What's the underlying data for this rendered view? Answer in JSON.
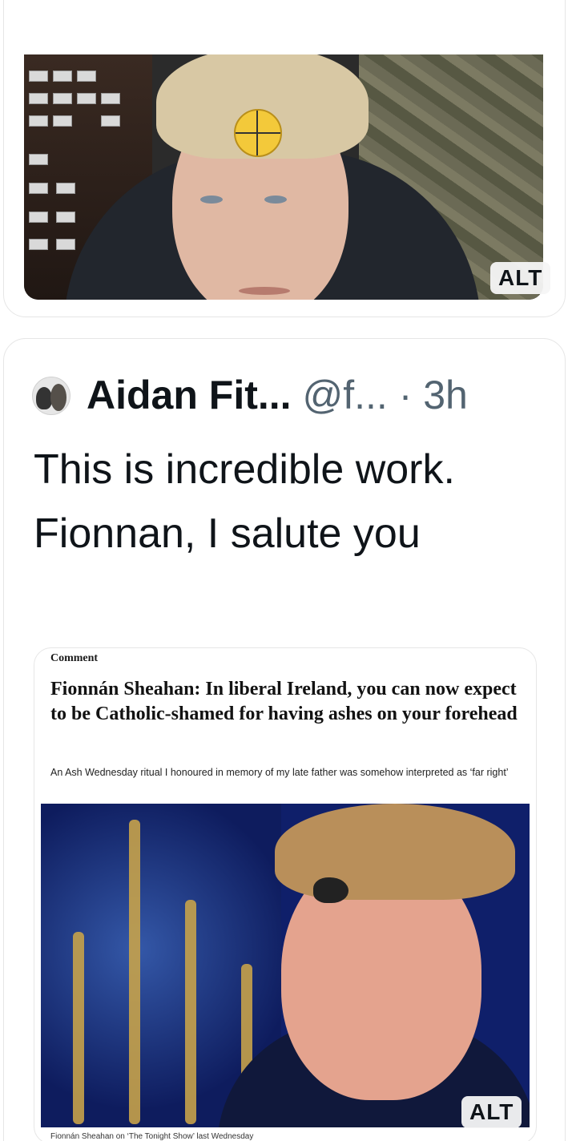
{
  "previous_tweet": {
    "image_alt_badge": "ALT"
  },
  "tweet": {
    "author_name": "Aidan Fit...",
    "handle": "@f...",
    "separator": "·",
    "time": "3h",
    "text": "This is incredible work. Fionnan, I salute you",
    "image_alt_badge": "ALT"
  },
  "article": {
    "section": "Comment",
    "headline": "Fionnán Sheahan: In liberal Ireland, you can now expect to be Catholic-shamed for having ashes on your forehead",
    "standfirst": "An Ash Wednesday ritual I honoured in memory of my late father was somehow interpreted as ‘far right’",
    "caption": "Fionnán Sheahan on ‘The Tonight Show’ last Wednesday"
  }
}
